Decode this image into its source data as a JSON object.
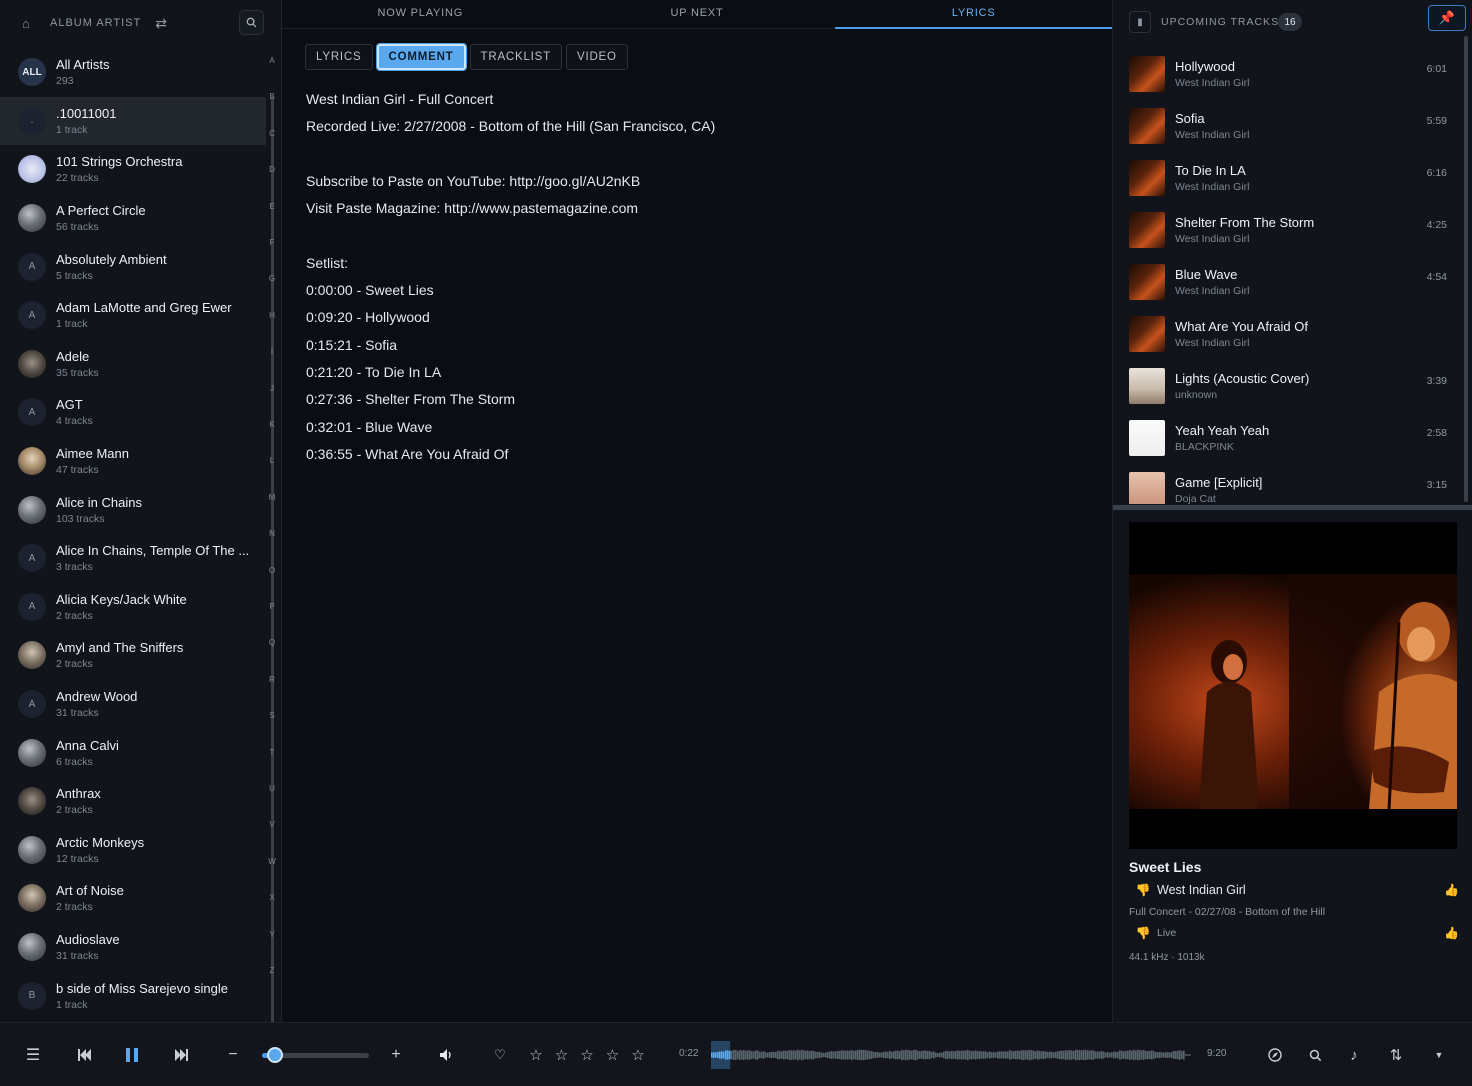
{
  "sidebar": {
    "title": "ALBUM ARTIST",
    "artists": [
      {
        "name": "All Artists",
        "count": "293",
        "avatar": "ALL",
        "avatar_style": "all"
      },
      {
        "name": ".10011001",
        "count": "1 track",
        "avatar": ".",
        "avatar_style": "letter",
        "selected": true
      },
      {
        "name": "101 Strings Orchestra",
        "count": "22 tracks",
        "avatar": "",
        "avatar_style": "img5"
      },
      {
        "name": "A Perfect Circle",
        "count": "56 tracks",
        "avatar": "",
        "avatar_style": "img"
      },
      {
        "name": "Absolutely Ambient",
        "count": "5 tracks",
        "avatar": "A",
        "avatar_style": "letter"
      },
      {
        "name": "Adam LaMotte and Greg Ewer",
        "count": "1 track",
        "avatar": "A",
        "avatar_style": "letter"
      },
      {
        "name": "Adele",
        "count": "35 tracks",
        "avatar": "",
        "avatar_style": "img4"
      },
      {
        "name": "AGT",
        "count": "4 tracks",
        "avatar": "A",
        "avatar_style": "letter"
      },
      {
        "name": "Aimee Mann",
        "count": "47 tracks",
        "avatar": "",
        "avatar_style": "img3"
      },
      {
        "name": "Alice in Chains",
        "count": "103 tracks",
        "avatar": "",
        "avatar_style": "img"
      },
      {
        "name": "Alice In Chains, Temple Of The ...",
        "count": "3 tracks",
        "avatar": "A",
        "avatar_style": "letter"
      },
      {
        "name": "Alicia Keys/Jack White",
        "count": "2 tracks",
        "avatar": "A",
        "avatar_style": "letter"
      },
      {
        "name": "Amyl and The Sniffers",
        "count": "2 tracks",
        "avatar": "",
        "avatar_style": "img2"
      },
      {
        "name": "Andrew Wood",
        "count": "31 tracks",
        "avatar": "A",
        "avatar_style": "letter"
      },
      {
        "name": "Anna Calvi",
        "count": "6 tracks",
        "avatar": "",
        "avatar_style": "img"
      },
      {
        "name": "Anthrax",
        "count": "2 tracks",
        "avatar": "",
        "avatar_style": "img4"
      },
      {
        "name": "Arctic Monkeys",
        "count": "12 tracks",
        "avatar": "",
        "avatar_style": "img"
      },
      {
        "name": "Art of Noise",
        "count": "2 tracks",
        "avatar": "",
        "avatar_style": "img2"
      },
      {
        "name": "Audioslave",
        "count": "31 tracks",
        "avatar": "",
        "avatar_style": "img"
      },
      {
        "name": "b side of Miss Sarejevo single",
        "count": "1 track",
        "avatar": "B",
        "avatar_style": "letter"
      }
    ],
    "alphabet": [
      "A",
      "B",
      "C",
      "D",
      "E",
      "F",
      "G",
      "H",
      "I",
      "J",
      "K",
      "L",
      "M",
      "N",
      "O",
      "P",
      "Q",
      "R",
      "S",
      "T",
      "U",
      "V",
      "W",
      "X",
      "Y",
      "Z"
    ]
  },
  "main": {
    "top_tabs": [
      {
        "label": "NOW PLAYING",
        "active": false
      },
      {
        "label": "UP NEXT",
        "active": false
      },
      {
        "label": "LYRICS",
        "active": true
      }
    ],
    "sub_tabs": [
      {
        "label": "LYRICS",
        "active": false
      },
      {
        "label": "COMMENT",
        "active": true
      },
      {
        "label": "TRACKLIST",
        "active": false
      },
      {
        "label": "VIDEO",
        "active": false
      }
    ],
    "comment_lines": [
      "West Indian Girl - Full Concert",
      "Recorded Live: 2/27/2008 - Bottom of the Hill (San Francisco, CA)",
      "",
      "Subscribe to Paste on YouTube: http://goo.gl/AU2nKB",
      "Visit Paste Magazine: http://www.pastemagazine.com",
      "",
      "Setlist:",
      "0:00:00 - Sweet Lies",
      "0:09:20 - Hollywood",
      "0:15:21 - Sofia",
      "0:21:20 - To Die In LA",
      "0:27:36 - Shelter From The Storm",
      "0:32:01 - Blue Wave",
      "0:36:55 - What Are You Afraid Of"
    ]
  },
  "right_panel": {
    "upcoming_label": "UPCOMING TRACKS",
    "upcoming_count": "16",
    "queue": [
      {
        "title": "Hollywood",
        "artist": "West Indian Girl",
        "duration": "6:01",
        "thumb": "concert"
      },
      {
        "title": "Sofia",
        "artist": "West Indian Girl",
        "duration": "5:59",
        "thumb": "concert"
      },
      {
        "title": "To Die In LA",
        "artist": "West Indian Girl",
        "duration": "6:16",
        "thumb": "concert"
      },
      {
        "title": "Shelter From The Storm",
        "artist": "West Indian Girl",
        "duration": "4:25",
        "thumb": "concert"
      },
      {
        "title": "Blue Wave",
        "artist": "West Indian Girl",
        "duration": "4:54",
        "thumb": "concert"
      },
      {
        "title": "What Are You Afraid Of",
        "artist": "West Indian Girl",
        "duration": "",
        "thumb": "concert"
      },
      {
        "title": "Lights (Acoustic Cover)",
        "artist": "unknown",
        "duration": "3:39",
        "thumb": "light"
      },
      {
        "title": "Yeah Yeah Yeah",
        "artist": "BLACKPINK",
        "duration": "2:58",
        "thumb": "white"
      },
      {
        "title": "Game [Explicit]",
        "artist": "Doja Cat",
        "duration": "3:15",
        "thumb": "peach"
      }
    ],
    "now_playing": {
      "title": "Sweet Lies",
      "artist": "West Indian Girl",
      "album": "Full Concert - 02/27/08 - Bottom of the Hill",
      "genre": "Live",
      "quality": "44.1 kHz · 1013k"
    }
  },
  "player": {
    "elapsed": "0:22",
    "total": "9:20",
    "volume_percent": 8,
    "progress_fraction": 0.04,
    "rating_stars": 0,
    "accent_color": "#4a9de8"
  }
}
